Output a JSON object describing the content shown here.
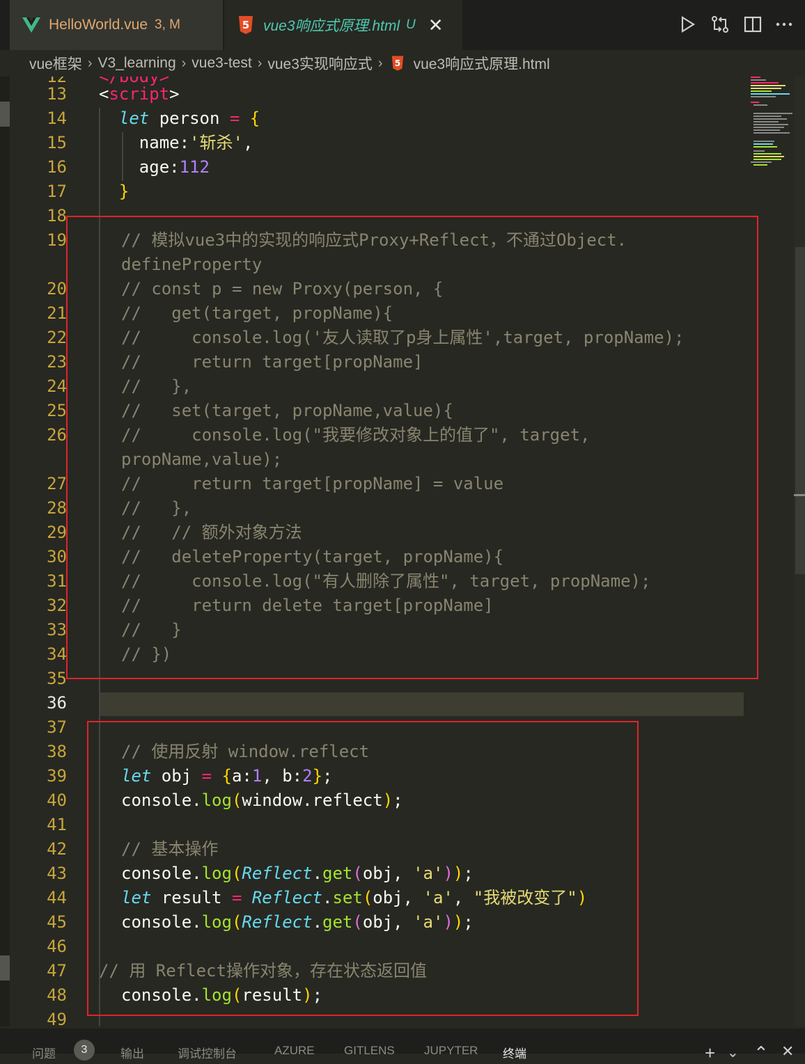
{
  "tabs": [
    {
      "label": "HelloWorld.vue",
      "badge": "3, M"
    },
    {
      "label": "vue3响应式原理.html",
      "badge": "U",
      "close": "✕"
    }
  ],
  "breadcrumb": [
    "vue框架",
    "V3_learning",
    "vue3-test",
    "vue3实现响应式",
    "vue3响应式原理.html"
  ],
  "colors": {
    "background": "#272822",
    "line_number": "#c8a53a",
    "highlight_box": "#e0242a",
    "comment": "#88846f",
    "keyword": "#66d9ef",
    "string": "#e6db74",
    "number": "#ae81ff",
    "function": "#a6e22e"
  },
  "toolbar_icons": [
    "run-icon",
    "compare-changes-icon",
    "split-editor-icon",
    "more-actions-icon"
  ],
  "editor": {
    "line_numbers": [
      "12",
      "13",
      "14",
      "15",
      "16",
      "17",
      "18",
      "19",
      "",
      "20",
      "21",
      "22",
      "23",
      "24",
      "25",
      "26",
      "",
      "27",
      "28",
      "29",
      "30",
      "31",
      "32",
      "33",
      "34",
      "35",
      "36",
      "37",
      "38",
      "39",
      "40",
      "41",
      "42",
      "43",
      "44",
      "45",
      "46",
      "47",
      "48",
      "49"
    ],
    "partial_line_top": "</body>",
    "lines": {
      "l13": {
        "t1": "<",
        "t2": "script",
        "t3": ">"
      },
      "l14": {
        "kw": "let",
        "name": " person ",
        "op": "=",
        "br": " {"
      },
      "l15": {
        "key": "name:",
        "str": "'斩杀'",
        "rest": ","
      },
      "l16": {
        "key": "age:",
        "num": "112"
      },
      "l17": {
        "br": "}"
      },
      "l19a": "// 模拟vue3中的实现的响应式Proxy+Reflect，不通过Object.",
      "l19b": "defineProperty",
      "l20": "// const p = new Proxy(person, {",
      "l21": "//   get(target, propName){",
      "l22": "//     console.log('友人读取了p身上属性',target, propName);",
      "l23": "//     return target[propName]",
      "l24": "//   },",
      "l25": "//   set(target, propName,value){",
      "l26a": "//     console.log(\"我要修改对象上的值了\", target,",
      "l26b": "propName,value);",
      "l27": "//     return target[propName] = value",
      "l28": "//   },",
      "l29": "//   // 额外对象方法",
      "l30": "//   deleteProperty(target, propName){",
      "l31": "//     console.log(\"有人删除了属性\", target, propName);",
      "l32": "//     return delete target[propName]",
      "l33": "//   }",
      "l34": "// })",
      "l38": "// 使用反射 window.reflect",
      "l39": {
        "kw": "let",
        "name": " obj ",
        "op": "=",
        "b1": " {",
        "k1": "a:",
        "n1": "1",
        "k2": ", b:",
        "n2": "2",
        "b2": "}",
        "end": ";"
      },
      "l40": {
        "obj": "console.",
        "fn": "log",
        "b1": "(",
        "arg": "window.reflect",
        "b2": ")",
        "end": ";"
      },
      "l42": "// 基本操作",
      "l43": {
        "obj": "console.",
        "fn": "log",
        "b1": "(",
        "cls": "Reflect",
        "dot": ".",
        "fn2": "get",
        "b2": "(",
        "arg": "obj, ",
        "str": "'a'",
        "b3": ")",
        "b4": ")",
        "end": ";"
      },
      "l44": {
        "kw": "let",
        "name": " result ",
        "op": "=",
        "cls": " Reflect",
        "dot": ".",
        "fn": "set",
        "b1": "(",
        "arg": "obj, ",
        "str1": "'a'",
        "sep": ", ",
        "str2": "\"我被改变了\"",
        "b2": ")"
      },
      "l45": {
        "obj": "console.",
        "fn": "log",
        "b1": "(",
        "cls": "Reflect",
        "dot": ".",
        "fn2": "get",
        "b2": "(",
        "arg": "obj, ",
        "str": "'a'",
        "b3": ")",
        "b4": ")",
        "end": ";"
      },
      "l47": "// 用 Reflect操作对象，存在状态返回值",
      "l48": {
        "obj": "console.",
        "fn": "log",
        "b1": "(",
        "arg": "result",
        "b2": ")",
        "end": ";"
      }
    }
  },
  "panel": {
    "tabs": [
      "问题",
      "输出",
      "调试控制台",
      "AZURE",
      "GITLENS",
      "JUPYTER",
      "终端"
    ],
    "problems_count": "3",
    "active_tab": "终端",
    "icons": {
      "add": "+",
      "dropdown": "⌄",
      "maximize": "⌃",
      "close": "✕"
    }
  }
}
